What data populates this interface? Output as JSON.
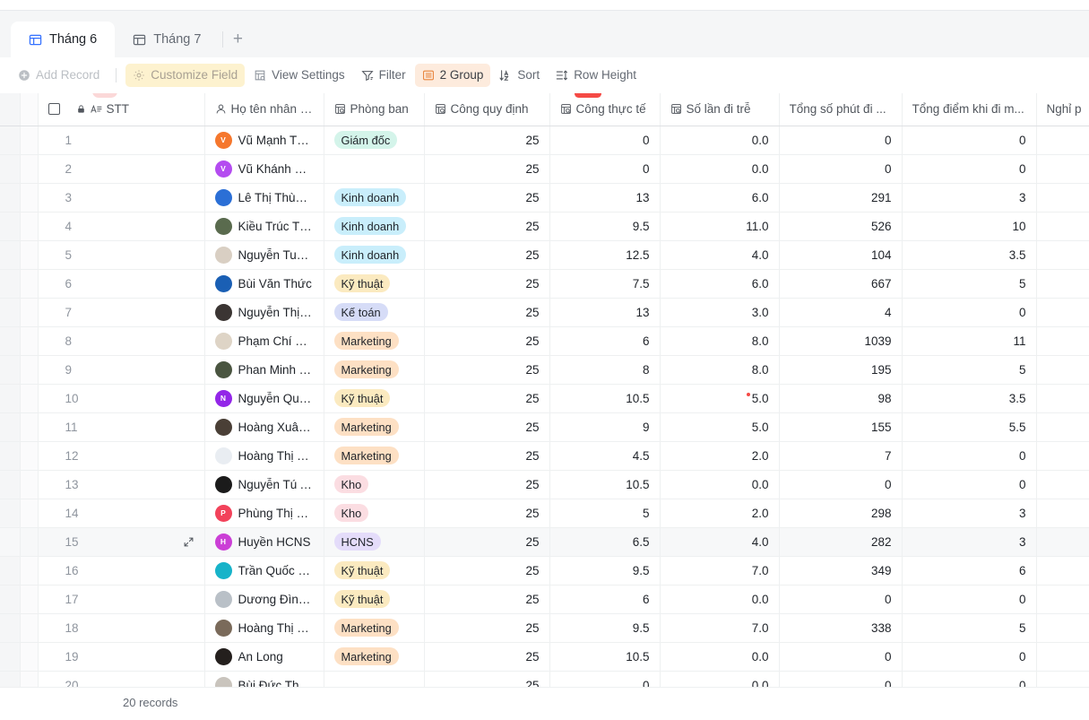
{
  "tabs": [
    {
      "label": "Tháng 6",
      "icon": "table-icon",
      "active": true
    },
    {
      "label": "Tháng 7",
      "icon": "table-icon",
      "active": false
    }
  ],
  "tab_add_label": "+",
  "toolbar": {
    "add_record": "Add Record",
    "customize_field": "Customize Field",
    "view_settings": "View Settings",
    "filter": "Filter",
    "group": "2 Group",
    "sort": "Sort",
    "row_height": "Row Height"
  },
  "colors": {
    "accent": "#3370ff",
    "group_highlight": "#fdebdd",
    "customize_highlight": "#fdf2cf",
    "error_dot": "#f54a45"
  },
  "columns": [
    {
      "label": "STT",
      "icon": "text-field-icon",
      "lock": true,
      "align": "left"
    },
    {
      "label": "Họ tên nhân viên",
      "icon": "person-icon",
      "align": "left"
    },
    {
      "label": "Phòng ban",
      "icon": "lookup-icon",
      "align": "left"
    },
    {
      "label": "Công quy định",
      "icon": "lookup-icon",
      "align": "right"
    },
    {
      "label": "Công thực tế",
      "icon": "lookup-icon",
      "align": "right"
    },
    {
      "label": "Số lần đi trễ",
      "icon": "lookup-icon",
      "align": "right"
    },
    {
      "label": "Tổng số phút đi ...",
      "icon": "",
      "align": "right"
    },
    {
      "label": "Tổng điểm khi đi m...",
      "icon": "",
      "align": "right"
    },
    {
      "label": "Nghỉ p",
      "icon": "",
      "align": "left"
    }
  ],
  "select_all_checkbox": false,
  "rows": [
    {
      "stt": "1",
      "name": "Vũ Mạnh Thắng",
      "avatar_initial": "V",
      "avatar_color": "#f5772d",
      "dept": "Giám đốc",
      "dept_bg": "#d4f4ea",
      "dept_fg": "#1f2329",
      "cong_quy_dinh": "25",
      "cong_thuc_te": "0",
      "so_lan_di_tre": "0.0",
      "tong_so_phut": "0",
      "tong_diem": "0"
    },
    {
      "stt": "2",
      "name": "Vũ Khánh Huyền",
      "avatar_initial": "V",
      "avatar_color": "#b44cf0",
      "dept": "",
      "dept_bg": "",
      "dept_fg": "",
      "cong_quy_dinh": "25",
      "cong_thuc_te": "0",
      "so_lan_di_tre": "0.0",
      "tong_so_phut": "0",
      "tong_diem": "0"
    },
    {
      "stt": "3",
      "name": "Lê Thị Thùy Anh",
      "avatar_initial": "",
      "avatar_color": "#2b6fd6",
      "dept": "Kinh doanh",
      "dept_bg": "#c9eefb",
      "dept_fg": "#1f2329",
      "cong_quy_dinh": "25",
      "cong_thuc_te": "13",
      "so_lan_di_tre": "6.0",
      "tong_so_phut": "291",
      "tong_diem": "3"
    },
    {
      "stt": "4",
      "name": "Kiều Trúc Tùng",
      "avatar_initial": "",
      "avatar_color": "#5a6b4e",
      "dept": "Kinh doanh",
      "dept_bg": "#c9eefb",
      "dept_fg": "#1f2329",
      "cong_quy_dinh": "25",
      "cong_thuc_te": "9.5",
      "so_lan_di_tre": "11.0",
      "tong_so_phut": "526",
      "tong_diem": "10"
    },
    {
      "stt": "5",
      "name": "Nguyễn Tuấn Anh",
      "avatar_initial": "",
      "avatar_color": "#d9cfc3",
      "dept": "Kinh doanh",
      "dept_bg": "#c9eefb",
      "dept_fg": "#1f2329",
      "cong_quy_dinh": "25",
      "cong_thuc_te": "12.5",
      "so_lan_di_tre": "4.0",
      "tong_so_phut": "104",
      "tong_diem": "3.5"
    },
    {
      "stt": "6",
      "name": "Bùi Văn Thức",
      "avatar_initial": "",
      "avatar_color": "#1a5fb4",
      "dept": "Kỹ thuật",
      "dept_bg": "#fbeac0",
      "dept_fg": "#1f2329",
      "cong_quy_dinh": "25",
      "cong_thuc_te": "7.5",
      "so_lan_di_tre": "6.0",
      "tong_so_phut": "667",
      "tong_diem": "5"
    },
    {
      "stt": "7",
      "name": "Nguyễn Thị Linh ...",
      "avatar_initial": "",
      "avatar_color": "#3b3533",
      "dept": "Kế toán",
      "dept_bg": "#d6dcf7",
      "dept_fg": "#1f2329",
      "cong_quy_dinh": "25",
      "cong_thuc_te": "13",
      "so_lan_di_tre": "3.0",
      "tong_so_phut": "4",
      "tong_diem": "0"
    },
    {
      "stt": "8",
      "name": "Phạm Chí Nguyên",
      "avatar_initial": "",
      "avatar_color": "#ded4c6",
      "dept": "Marketing",
      "dept_bg": "#fde0c4",
      "dept_fg": "#1f2329",
      "cong_quy_dinh": "25",
      "cong_thuc_te": "6",
      "so_lan_di_tre": "8.0",
      "tong_so_phut": "1039",
      "tong_diem": "11"
    },
    {
      "stt": "9",
      "name": "Phan Minh Thắng",
      "avatar_initial": "",
      "avatar_color": "#4a5540",
      "dept": "Marketing",
      "dept_bg": "#fde0c4",
      "dept_fg": "#1f2329",
      "cong_quy_dinh": "25",
      "cong_thuc_te": "8",
      "so_lan_di_tre": "8.0",
      "tong_so_phut": "195",
      "tong_diem": "5"
    },
    {
      "stt": "10",
      "name": "Nguyễn Quốc Huy",
      "avatar_initial": "N",
      "avatar_color": "#9326e8",
      "dept": "Kỹ thuật",
      "dept_bg": "#fbeac0",
      "dept_fg": "#1f2329",
      "cong_quy_dinh": "25",
      "cong_thuc_te": "10.5",
      "so_lan_di_tre": "5.0",
      "tong_so_phut": "98",
      "tong_diem": "3.5",
      "error": true
    },
    {
      "stt": "11",
      "name": "Hoàng Xuân Duy",
      "avatar_initial": "",
      "avatar_color": "#4a3f36",
      "dept": "Marketing",
      "dept_bg": "#fde0c4",
      "dept_fg": "#1f2329",
      "cong_quy_dinh": "25",
      "cong_thuc_te": "9",
      "so_lan_di_tre": "5.0",
      "tong_so_phut": "155",
      "tong_diem": "5.5"
    },
    {
      "stt": "12",
      "name": "Hoàng Thị Yến",
      "avatar_initial": "",
      "avatar_color": "#e9edf2",
      "dept": "Marketing",
      "dept_bg": "#fde0c4",
      "dept_fg": "#1f2329",
      "cong_quy_dinh": "25",
      "cong_thuc_te": "4.5",
      "so_lan_di_tre": "2.0",
      "tong_so_phut": "7",
      "tong_diem": "0"
    },
    {
      "stt": "13",
      "name": "Nguyễn Tú An",
      "avatar_initial": "",
      "avatar_color": "#1b1b1b",
      "dept": "Kho",
      "dept_bg": "#fbdde2",
      "dept_fg": "#1f2329",
      "cong_quy_dinh": "25",
      "cong_thuc_te": "10.5",
      "so_lan_di_tre": "0.0",
      "tong_so_phut": "0",
      "tong_diem": "0"
    },
    {
      "stt": "14",
      "name": "Phùng Thị Liên",
      "avatar_initial": "P",
      "avatar_color": "#f2425a",
      "dept": "Kho",
      "dept_bg": "#fbdde2",
      "dept_fg": "#1f2329",
      "cong_quy_dinh": "25",
      "cong_thuc_te": "5",
      "so_lan_di_tre": "2.0",
      "tong_so_phut": "298",
      "tong_diem": "3"
    },
    {
      "stt": "15",
      "name": "Huyền HCNS",
      "avatar_initial": "H",
      "avatar_color": "#cb3fd6",
      "dept": "HCNS",
      "dept_bg": "#e4dcfa",
      "dept_fg": "#1f2329",
      "cong_quy_dinh": "25",
      "cong_thuc_te": "6.5",
      "so_lan_di_tre": "4.0",
      "tong_so_phut": "282",
      "tong_diem": "3",
      "hover": true
    },
    {
      "stt": "16",
      "name": "Trần Quốc Hoàn",
      "avatar_initial": "",
      "avatar_color": "#17b3c9",
      "dept": "Kỹ thuật",
      "dept_bg": "#fbeac0",
      "dept_fg": "#1f2329",
      "cong_quy_dinh": "25",
      "cong_thuc_te": "9.5",
      "so_lan_di_tre": "7.0",
      "tong_so_phut": "349",
      "tong_diem": "6"
    },
    {
      "stt": "17",
      "name": "Dương Đình Ngọc",
      "avatar_initial": "",
      "avatar_color": "#b9c0c7",
      "dept": "Kỹ thuật",
      "dept_bg": "#fbeac0",
      "dept_fg": "#1f2329",
      "cong_quy_dinh": "25",
      "cong_thuc_te": "6",
      "so_lan_di_tre": "0.0",
      "tong_so_phut": "0",
      "tong_diem": "0"
    },
    {
      "stt": "18",
      "name": "Hoàng Thị Quỳnh...",
      "avatar_initial": "",
      "avatar_color": "#7a6a5a",
      "dept": "Marketing",
      "dept_bg": "#fde0c4",
      "dept_fg": "#1f2329",
      "cong_quy_dinh": "25",
      "cong_thuc_te": "9.5",
      "so_lan_di_tre": "7.0",
      "tong_so_phut": "338",
      "tong_diem": "5"
    },
    {
      "stt": "19",
      "name": "An Long",
      "avatar_initial": "",
      "avatar_color": "#241f1d",
      "dept": "Marketing",
      "dept_bg": "#fde0c4",
      "dept_fg": "#1f2329",
      "cong_quy_dinh": "25",
      "cong_thuc_te": "10.5",
      "so_lan_di_tre": "0.0",
      "tong_so_phut": "0",
      "tong_diem": "0"
    },
    {
      "stt": "20",
      "name": "Bùi Đức Thiện",
      "avatar_initial": "",
      "avatar_color": "#c9c4bd",
      "dept": "",
      "dept_bg": "",
      "dept_fg": "",
      "cong_quy_dinh": "25",
      "cong_thuc_te": "0",
      "so_lan_di_tre": "0.0",
      "tong_so_phut": "0",
      "tong_diem": "0"
    }
  ],
  "footer": {
    "record_count": "20 records"
  }
}
